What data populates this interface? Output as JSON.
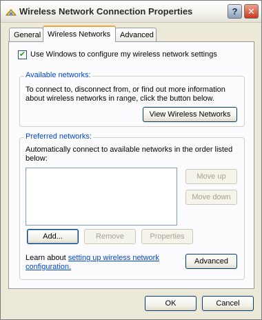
{
  "window": {
    "title": "Wireless Network Connection Properties",
    "help_label": "?",
    "close_label": "✕"
  },
  "tabs": [
    {
      "label": "General"
    },
    {
      "label": "Wireless Networks"
    },
    {
      "label": "Advanced"
    }
  ],
  "use_windows_checkbox": {
    "checked": true,
    "label": "Use Windows to configure my wireless network settings"
  },
  "available_networks": {
    "legend": "Available networks:",
    "line1": "To connect to, disconnect from, or find out more information",
    "line2": "about wireless networks in range, click the button below.",
    "view_button": "View Wireless Networks"
  },
  "preferred_networks": {
    "legend": "Preferred networks:",
    "line1": "Automatically connect to available networks in the order listed",
    "line2": "below:",
    "items": [],
    "move_up": "Move up",
    "move_down": "Move down",
    "add": "Add...",
    "remove": "Remove",
    "properties": "Properties",
    "learn_prefix": "Learn about ",
    "learn_link_line1": "setting up wireless network",
    "learn_link_line2": "configuration.",
    "advanced": "Advanced"
  },
  "footer": {
    "ok": "OK",
    "cancel": "Cancel"
  },
  "colors": {
    "dialog_bg": "#ece9d8",
    "panel_bg": "#fcfcfe",
    "group_legend": "#0046d5",
    "link": "#0046d5",
    "active_tab_accent": "#f0a23b",
    "close_button": "#c7391f"
  },
  "icons": {
    "app": "network-connection-icon",
    "help": "help-icon",
    "close": "close-icon"
  }
}
